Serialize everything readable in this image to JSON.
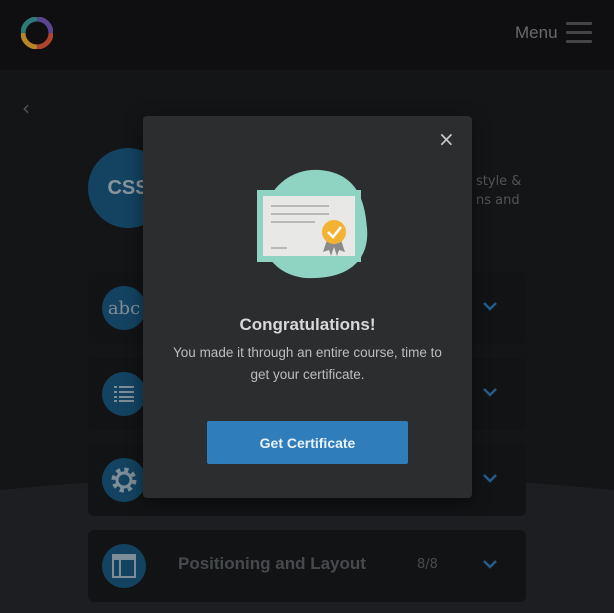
{
  "header": {
    "menu_label": "Menu"
  },
  "course": {
    "badge": "CSS",
    "description_fragment": "style &\nns and"
  },
  "sections": [
    {
      "icon": "abc-icon",
      "title": "",
      "count": ""
    },
    {
      "icon": "list-icon",
      "title": "",
      "count": ""
    },
    {
      "icon": "gear-icon",
      "title": "",
      "count": ""
    },
    {
      "icon": "layout-icon",
      "title": "Positioning and Layout",
      "count": "8/8"
    }
  ],
  "modal": {
    "close_label": "×",
    "heading": "Congratulations!",
    "message": "You made it through an entire course, time to get your certificate.",
    "cta_label": "Get Certificate"
  },
  "colors": {
    "accent": "#2f7dbb",
    "badge": "#1a5a82",
    "certificate_teal": "#8fd3c2",
    "medal": "#f2b233"
  }
}
